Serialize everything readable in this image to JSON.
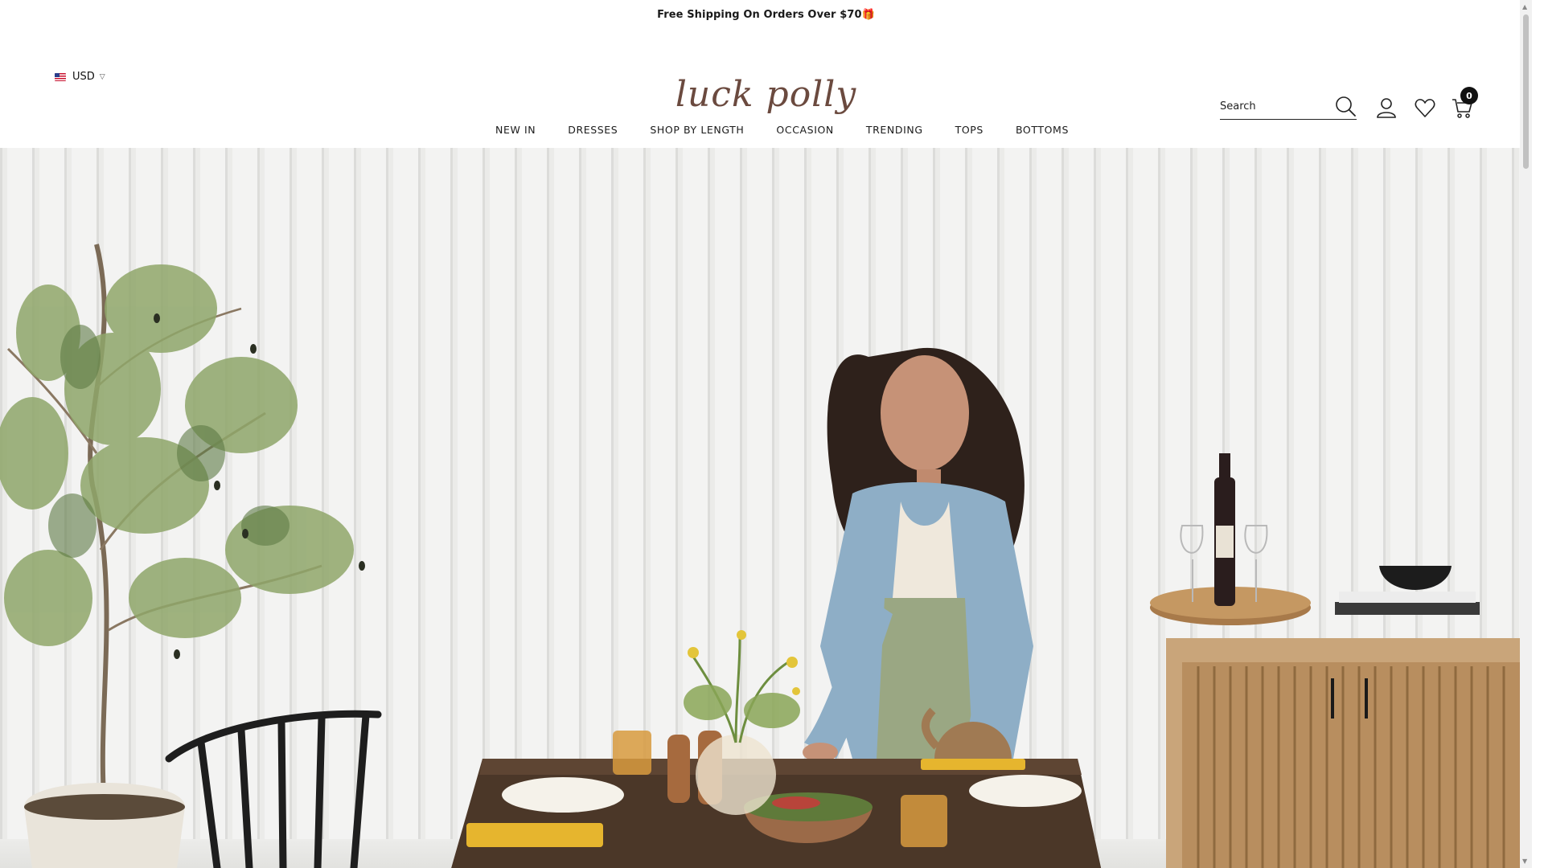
{
  "announcement": {
    "text": "Free Shipping On Orders Over $70🎁"
  },
  "header": {
    "currency": "USD",
    "logo_text": "luck polly",
    "search_placeholder": "Search",
    "cart_count": "0"
  },
  "nav": {
    "items": [
      {
        "label": "NEW IN"
      },
      {
        "label": "DRESSES"
      },
      {
        "label": "SHOP BY LENGTH"
      },
      {
        "label": "OCCASION"
      },
      {
        "label": "TRENDING"
      },
      {
        "label": "TOPS"
      },
      {
        "label": "BOTTOMS"
      }
    ]
  },
  "icons": {
    "search": "search-icon",
    "account": "user-icon",
    "wishlist": "heart-icon",
    "cart": "cart-icon"
  },
  "colors": {
    "logo": "#6b4a3f",
    "text": "#1a1a1a",
    "badge": "#111111"
  }
}
